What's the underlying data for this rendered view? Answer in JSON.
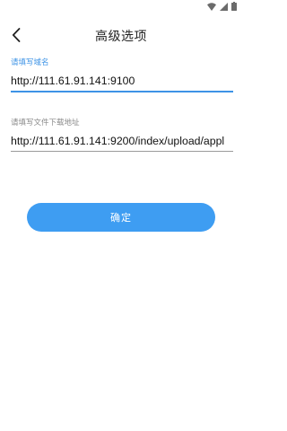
{
  "colors": {
    "accent": "#3d93e6",
    "button": "#3e9df2",
    "background": "#ffffff",
    "underline": "#9a9a9a"
  },
  "status_bar": {
    "icons": [
      "wifi-icon",
      "signal-icon",
      "battery-icon"
    ]
  },
  "toolbar": {
    "back_icon": "chevron-left-icon",
    "title": "高级选项"
  },
  "form": {
    "domain": {
      "label": "请填写域名",
      "value": "http://111.61.91.141:9100"
    },
    "download": {
      "label": "请填写文件下载地址",
      "value": "http://111.61.91.141:9200/index/upload/appl"
    },
    "confirm_label": "确定"
  }
}
